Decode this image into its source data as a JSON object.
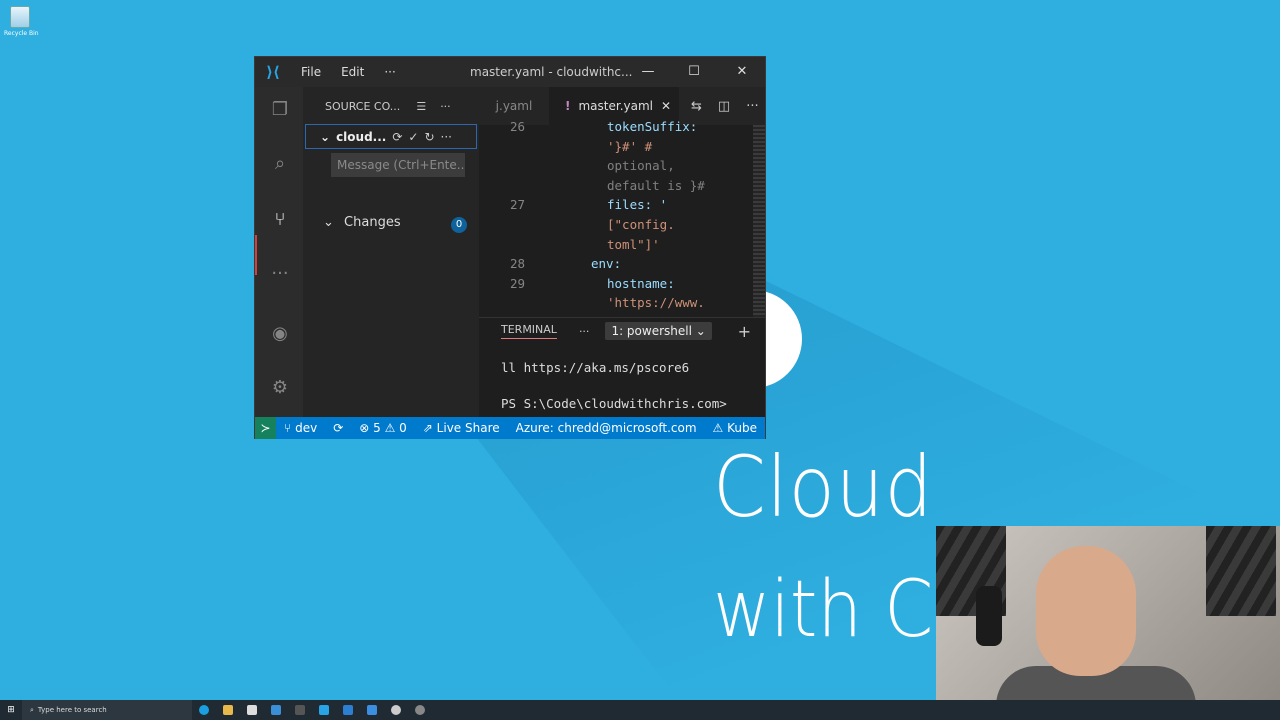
{
  "desktop": {
    "icon_label": "Recycle Bin",
    "brand_line1": "Cloud",
    "brand_line2": "with Ch"
  },
  "window": {
    "title": "master.yaml - cloudwithc...",
    "menu": [
      "File",
      "Edit",
      "···"
    ],
    "controls": {
      "minimize": "—",
      "maximize": "☐",
      "close": "✕"
    }
  },
  "sidebar": {
    "header": "SOURCE CO...",
    "repo_name": "cloud...",
    "message_placeholder": "Message (Ctrl+Ente...",
    "changes_label": "Changes",
    "changes_count": "0"
  },
  "editor": {
    "tab_inactive": "j.yaml",
    "tab_active": "master.yaml",
    "tab_active_marker": "!",
    "lines": [
      {
        "num": "26",
        "text": "tokenSuffix:",
        "cls": "k"
      },
      {
        "num": "",
        "text": "'}#' #",
        "cls": "s"
      },
      {
        "num": "",
        "text": "optional,",
        "cls": "g"
      },
      {
        "num": "",
        "text": "default is }#",
        "cls": "g"
      },
      {
        "num": "27",
        "text": "files: '",
        "cls": "k"
      },
      {
        "num": "",
        "text": "[\"config.",
        "cls": "s"
      },
      {
        "num": "",
        "text": "toml\"]'",
        "cls": "s"
      },
      {
        "num": "28",
        "text": "env:",
        "cls": "k"
      },
      {
        "num": "29",
        "text": "hostname:",
        "cls": "k"
      },
      {
        "num": "",
        "text": "'https://www.",
        "cls": "s"
      }
    ]
  },
  "terminal": {
    "tab": "TERMINAL",
    "shell": "1: powershell",
    "line1": "ll https://aka.ms/pscore6",
    "line2": "PS S:\\Code\\cloudwithchris.com>"
  },
  "statusbar": {
    "branch": "dev",
    "errors": "5",
    "warnings": "0",
    "live_share": "Live Share",
    "azure": "Azure: chredd@microsoft.com",
    "kube": "Kube"
  },
  "taskbar": {
    "search_placeholder": "Type here to search"
  }
}
